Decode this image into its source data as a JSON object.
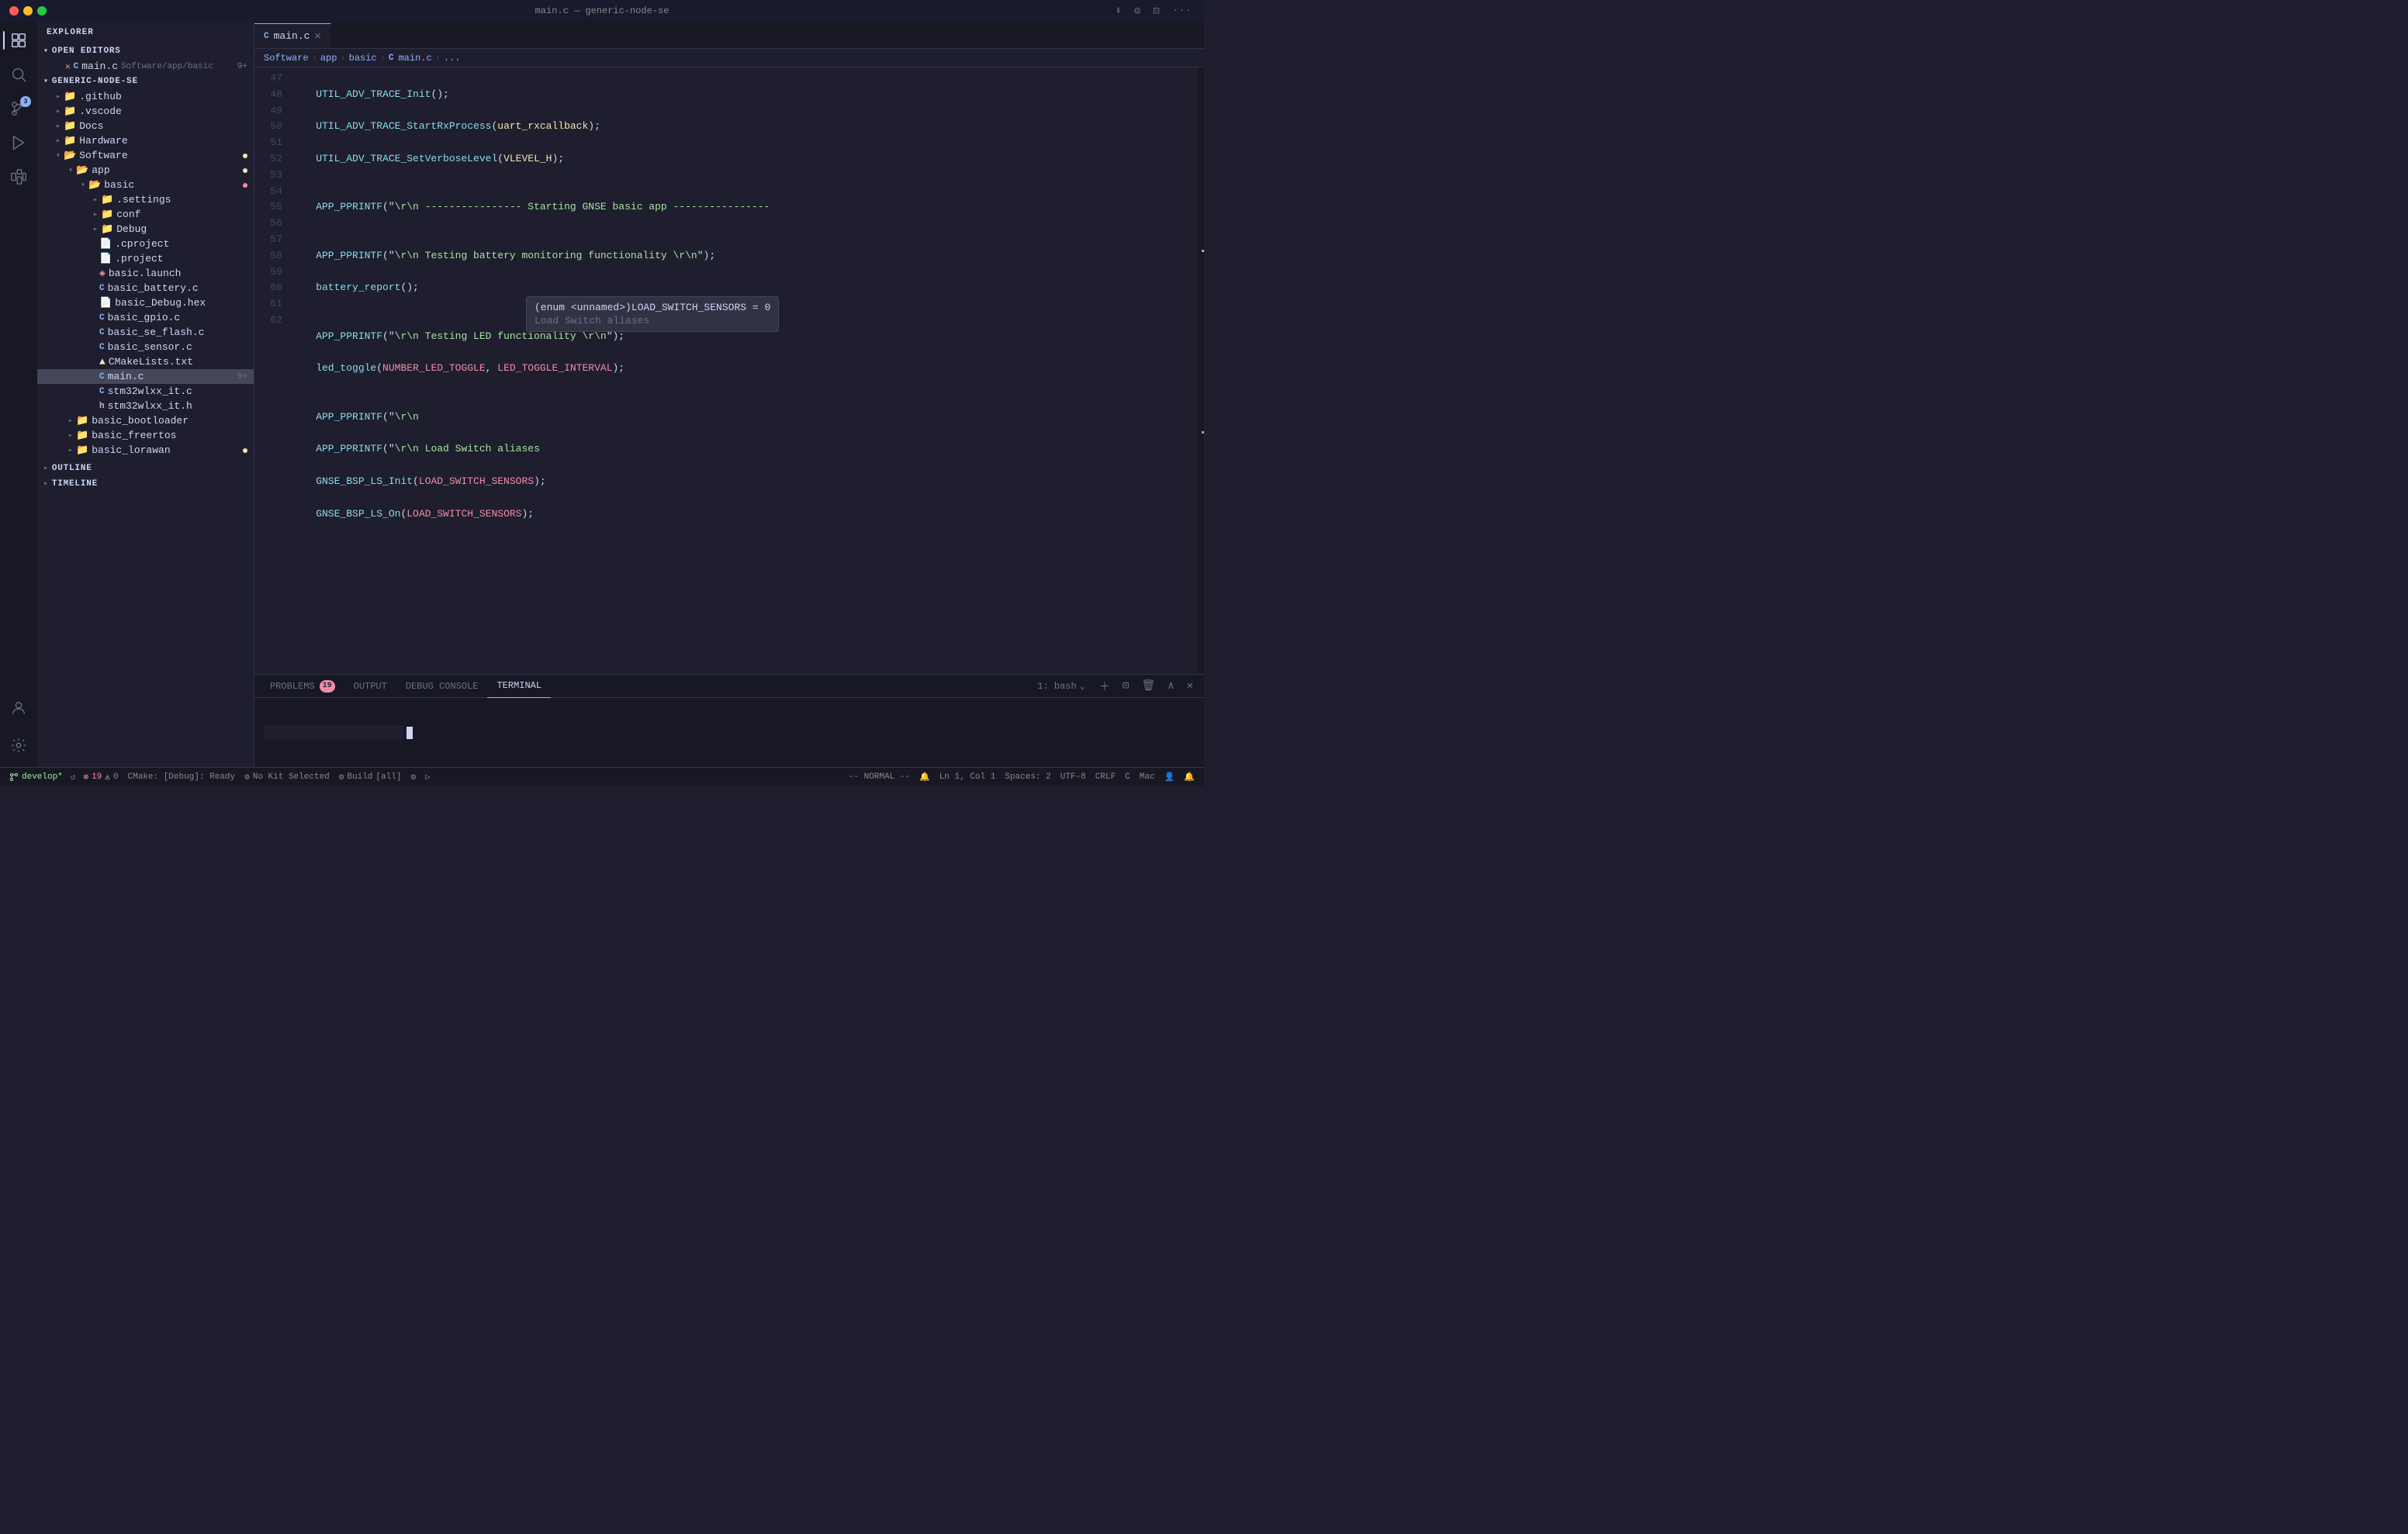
{
  "titlebar": {
    "title": "main.c — generic-node-se",
    "buttons": [
      "install",
      "debug",
      "split",
      "more"
    ]
  },
  "activitybar": {
    "icons": [
      {
        "name": "explorer",
        "active": true,
        "badge": null
      },
      {
        "name": "search",
        "active": false,
        "badge": null
      },
      {
        "name": "source-control",
        "active": false,
        "badge": "3"
      },
      {
        "name": "run-debug",
        "active": false,
        "badge": null
      },
      {
        "name": "extensions",
        "active": false,
        "badge": null
      },
      {
        "name": "testing",
        "active": false,
        "badge": null
      }
    ]
  },
  "sidebar": {
    "header": "Explorer",
    "open_editors_label": "Open Editors",
    "open_editors": [
      {
        "name": "main.c",
        "path": "Software/app/basic",
        "badge": "9+",
        "modified": false
      }
    ],
    "root_label": "Generic-Node-SE",
    "tree": [
      {
        "label": ".github",
        "type": "folder",
        "depth": 1,
        "expanded": false
      },
      {
        "label": ".vscode",
        "type": "folder",
        "depth": 1,
        "expanded": false
      },
      {
        "label": "Docs",
        "type": "folder",
        "depth": 1,
        "expanded": false
      },
      {
        "label": "Hardware",
        "type": "folder",
        "depth": 1,
        "expanded": false
      },
      {
        "label": "Software",
        "type": "folder",
        "depth": 1,
        "expanded": true,
        "dot": "orange"
      },
      {
        "label": "app",
        "type": "folder",
        "depth": 2,
        "expanded": true,
        "dot": "orange"
      },
      {
        "label": "basic",
        "type": "folder",
        "depth": 3,
        "expanded": true,
        "dot": "red"
      },
      {
        "label": ".settings",
        "type": "folder",
        "depth": 4,
        "expanded": false
      },
      {
        "label": "conf",
        "type": "folder",
        "depth": 4,
        "expanded": false
      },
      {
        "label": "Debug",
        "type": "folder",
        "depth": 4,
        "expanded": false
      },
      {
        "label": ".cproject",
        "type": "file-generic",
        "depth": 4
      },
      {
        "label": ".project",
        "type": "file-generic",
        "depth": 4
      },
      {
        "label": "basic.launch",
        "type": "file-xml",
        "depth": 4
      },
      {
        "label": "basic_battery.c",
        "type": "file-c",
        "depth": 4
      },
      {
        "label": "basic_Debug.hex",
        "type": "file-generic",
        "depth": 4
      },
      {
        "label": "basic_gpio.c",
        "type": "file-c",
        "depth": 4
      },
      {
        "label": "basic_se_flash.c",
        "type": "file-c",
        "depth": 4
      },
      {
        "label": "basic_sensor.c",
        "type": "file-c",
        "depth": 4
      },
      {
        "label": "CMakeLists.txt",
        "type": "file-cmake",
        "depth": 4
      },
      {
        "label": "main.c",
        "type": "file-c",
        "depth": 4,
        "active": true,
        "badge": "9+"
      },
      {
        "label": "stm32wlxx_it.c",
        "type": "file-c",
        "depth": 4
      },
      {
        "label": "stm32wlxx_it.h",
        "type": "file-h",
        "depth": 4
      },
      {
        "label": "basic_bootloader",
        "type": "folder",
        "depth": 2,
        "expanded": false
      },
      {
        "label": "basic_freertos",
        "type": "folder",
        "depth": 2,
        "expanded": false
      },
      {
        "label": "basic_lorawan",
        "type": "folder",
        "depth": 2,
        "expanded": false,
        "dot": "yellow"
      }
    ],
    "outline_label": "Outline",
    "timeline_label": "Timeline"
  },
  "editor": {
    "tab_label": "main.c",
    "breadcrumb": [
      "Software",
      "app",
      "basic",
      "main.c",
      "..."
    ],
    "lines": [
      {
        "num": 47,
        "content": "    UTIL_ADV_TRACE_Init();",
        "tokens": [
          {
            "text": "    ",
            "cls": ""
          },
          {
            "text": "UTIL_ADV_TRACE_Init",
            "cls": "c-fn"
          },
          {
            "text": "();",
            "cls": "c-white"
          }
        ]
      },
      {
        "num": 48,
        "content": "    UTIL_ADV_TRACE_StartRxProcess(uart_rxcallback);",
        "tokens": [
          {
            "text": "    ",
            "cls": ""
          },
          {
            "text": "UTIL_ADV_TRACE_StartRxProcess",
            "cls": "c-fn"
          },
          {
            "text": "(",
            "cls": "c-white"
          },
          {
            "text": "uart_rxcallback",
            "cls": "c-yellow"
          },
          {
            "text": ");",
            "cls": "c-white"
          }
        ]
      },
      {
        "num": 49,
        "content": "    UTIL_ADV_TRACE_SetVerboseLevel(VLEVEL_H);",
        "tokens": [
          {
            "text": "    ",
            "cls": ""
          },
          {
            "text": "UTIL_ADV_TRACE_SetVerboseLevel",
            "cls": "c-fn"
          },
          {
            "text": "(",
            "cls": "c-white"
          },
          {
            "text": "VLEVEL_H",
            "cls": "c-yellow"
          },
          {
            "text": ");",
            "cls": "c-white"
          }
        ]
      },
      {
        "num": 50,
        "content": ""
      },
      {
        "num": 51,
        "content": "    APP_PPRINTF(\"\\r\\n ---------------- Starting GNSE basic app ----------------",
        "tokens": [
          {
            "text": "    ",
            "cls": ""
          },
          {
            "text": "APP_PPRINTF",
            "cls": "c-fn"
          },
          {
            "text": "(\"",
            "cls": "c-white"
          },
          {
            "text": "\\r\\n ---------------- Starting GNSE basic app ----------------",
            "cls": "c-green"
          }
        ]
      },
      {
        "num": 52,
        "content": ""
      },
      {
        "num": 53,
        "content": "    APP_PPRINTF(\"\\r\\n Testing battery monitoring functionality \\r\\n\");",
        "tokens": [
          {
            "text": "    ",
            "cls": ""
          },
          {
            "text": "APP_PPRINTF",
            "cls": "c-fn"
          },
          {
            "text": "(\"",
            "cls": "c-white"
          },
          {
            "text": "\\r\\n Testing battery monitoring functionality \\r\\n",
            "cls": "c-green"
          },
          {
            "text": "\");",
            "cls": "c-white"
          }
        ]
      },
      {
        "num": 54,
        "content": "    battery_report();",
        "tokens": [
          {
            "text": "    ",
            "cls": ""
          },
          {
            "text": "battery_report",
            "cls": "c-fn"
          },
          {
            "text": "();",
            "cls": "c-white"
          }
        ]
      },
      {
        "num": 55,
        "content": ""
      },
      {
        "num": 56,
        "content": "    APP_PPRINTF(\"\\r\\n Testing LED functionality \\r\\n\");",
        "tokens": [
          {
            "text": "    ",
            "cls": ""
          },
          {
            "text": "APP_PPRINTF",
            "cls": "c-fn"
          },
          {
            "text": "(\"",
            "cls": "c-white"
          },
          {
            "text": "\\r\\n Testing LED functionality \\r\\n",
            "cls": "c-green"
          },
          {
            "text": "\");",
            "cls": "c-white"
          }
        ]
      },
      {
        "num": 57,
        "content": "    led_toggle(NUMBER_LED_TOGGLE, LED_TOGGLE_INTERVAL);",
        "tokens": [
          {
            "text": "    ",
            "cls": ""
          },
          {
            "text": "led_toggle",
            "cls": "c-fn"
          },
          {
            "text": "(",
            "cls": "c-white"
          },
          {
            "text": "NUMBER_LED_TOGGLE",
            "cls": "c-red"
          },
          {
            "text": ", ",
            "cls": "c-white"
          },
          {
            "text": "LED_TOGGLE_INTERVAL",
            "cls": "c-red"
          },
          {
            "text": ");",
            "cls": "c-white"
          }
        ]
      },
      {
        "num": 58,
        "content": ""
      },
      {
        "num": 59,
        "content": "    APP_PPRINTF(\"\\r\\n",
        "tokens": [
          {
            "text": "    ",
            "cls": ""
          },
          {
            "text": "APP_PPRINTF",
            "cls": "c-fn"
          },
          {
            "text": "(\"",
            "cls": "c-white"
          },
          {
            "text": "\\r\\n",
            "cls": "c-green"
          }
        ]
      },
      {
        "num": 60,
        "content": "    APP_PPRINTF(\"\\r\\n Load Switch aliases",
        "tokens": [
          {
            "text": "    ",
            "cls": ""
          },
          {
            "text": "APP_PPRINTF",
            "cls": "c-fn"
          },
          {
            "text": "(\"",
            "cls": "c-white"
          },
          {
            "text": "\\r\\n Load Switch aliases",
            "cls": "c-green"
          }
        ]
      },
      {
        "num": 61,
        "content": "    GNSE_BSP_LS_Init(LOAD_SWITCH_SENSORS);",
        "tokens": [
          {
            "text": "    ",
            "cls": ""
          },
          {
            "text": "GNSE_BSP_LS_Init",
            "cls": "c-fn"
          },
          {
            "text": "(",
            "cls": "c-white"
          },
          {
            "text": "LOAD_SWITCH_SENSORS",
            "cls": "c-red"
          },
          {
            "text": ");",
            "cls": "c-white"
          }
        ]
      },
      {
        "num": 62,
        "content": "    GNSE_BSP_LS_On(LOAD_SWITCH_SENSORS);",
        "tokens": [
          {
            "text": "    ",
            "cls": ""
          },
          {
            "text": "GNSE_BSP_LS_On",
            "cls": "c-fn"
          },
          {
            "text": "(",
            "cls": "c-white"
          },
          {
            "text": "LOAD_SWITCH_SENSORS",
            "cls": "c-red"
          },
          {
            "text": ");",
            "cls": "c-white"
          }
        ]
      }
    ],
    "tooltip": {
      "line1": "(enum <unnamed>)LOAD_SWITCH_SENSORS = 0",
      "line2": "Load Switch aliases"
    }
  },
  "panel": {
    "tabs": [
      "PROBLEMS",
      "OUTPUT",
      "DEBUG CONSOLE",
      "TERMINAL"
    ],
    "active_tab": "TERMINAL",
    "problems_count": "19",
    "terminal_selector": "1: bash"
  },
  "statusbar": {
    "branch": "develop*",
    "errors": "19",
    "warnings": "0",
    "cmake": "CMake: [Debug]: Ready",
    "kit": "No Kit Selected",
    "build": "Build",
    "build_target": "[all]",
    "vim_mode": "-- NORMAL --",
    "line": "Ln 1, Col 1",
    "spaces": "Spaces: 2",
    "encoding": "UTF-8",
    "line_ending": "CRLF",
    "language": "C",
    "platform": "Mac"
  }
}
